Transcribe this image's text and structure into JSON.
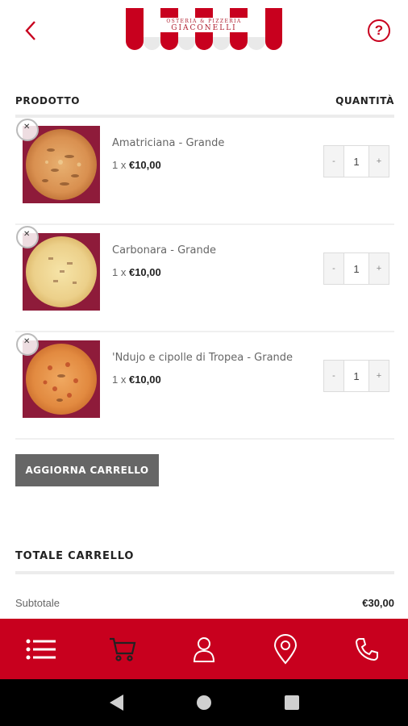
{
  "header": {
    "logo_line1": "OSTERIA & PIZZERIA",
    "logo_line2": "GIACONELLI",
    "help_symbol": "?",
    "back_icon": "chevron-left-icon",
    "accent_color": "#c8001e"
  },
  "table": {
    "product_header": "PRODOTTO",
    "quantity_header": "QUANTITÀ"
  },
  "items": [
    {
      "name": "Amatriciana - Grande",
      "qty_prefix": "1 x",
      "price": "€10,00",
      "quantity": "1",
      "minus": "-",
      "plus": "+"
    },
    {
      "name": "Carbonara - Grande",
      "qty_prefix": "1 x",
      "price": "€10,00",
      "quantity": "1",
      "minus": "-",
      "plus": "+"
    },
    {
      "name": "'Ndujo e cipolle di Tropea - Grande",
      "qty_prefix": "1 x",
      "price": "€10,00",
      "quantity": "1",
      "minus": "-",
      "plus": "+"
    }
  ],
  "actions": {
    "update_cart": "AGGIORNA CARRELLO"
  },
  "totals": {
    "title": "TOTALE CARRELLO",
    "subtotal_label": "Subtotale",
    "subtotal_value": "€30,00"
  },
  "bottom_nav": {
    "items": [
      "menu-list-icon",
      "cart-icon",
      "user-icon",
      "location-pin-icon",
      "phone-icon"
    ]
  }
}
